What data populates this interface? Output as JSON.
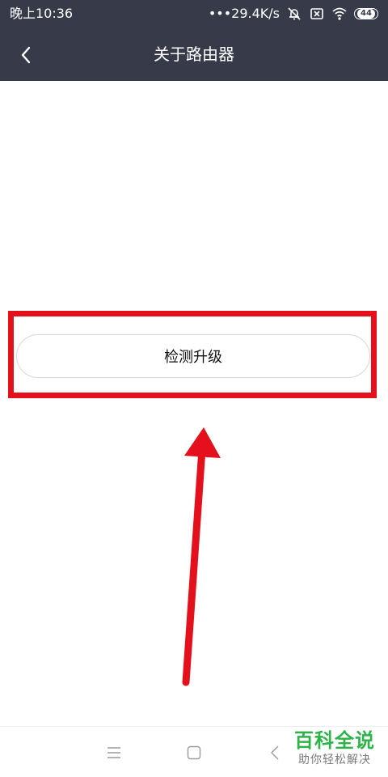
{
  "status_bar": {
    "time": "晚上10:36",
    "network_speed": "•••29.4K/s",
    "battery_level": "44"
  },
  "header": {
    "title": "关于路由器"
  },
  "main": {
    "check_update_label": "检测升级"
  },
  "watermark": {
    "main": "百科全说",
    "sub": "助你轻松解决"
  },
  "colors": {
    "header_bg": "#363a49",
    "highlight": "#e4101c",
    "watermark_green": "#2eb34a"
  }
}
